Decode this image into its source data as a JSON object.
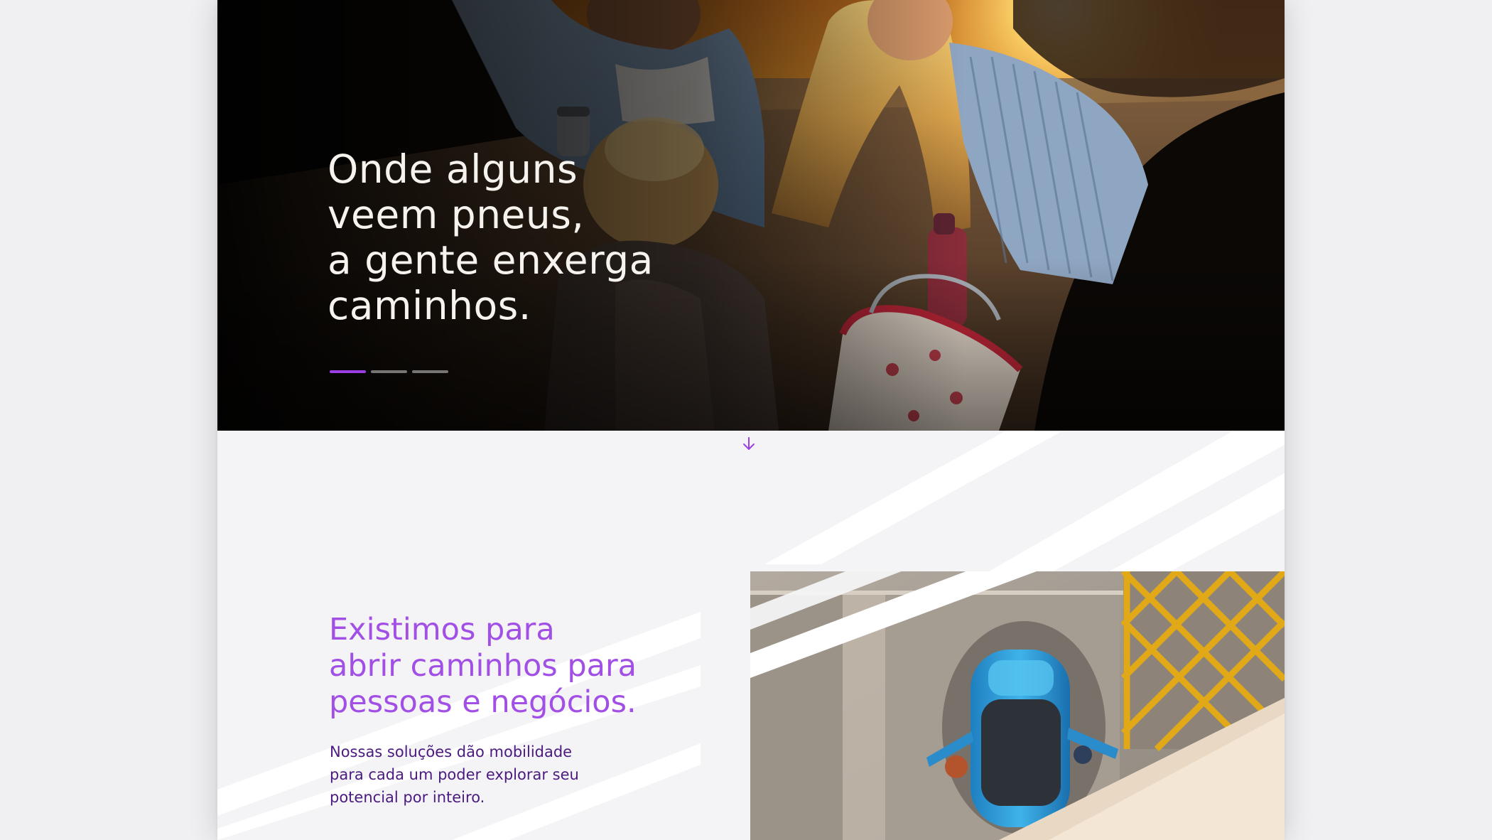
{
  "hero": {
    "title_lines": [
      "Onde alguns",
      "veem pneus,",
      "a gente enxerga",
      "caminhos."
    ],
    "slides": {
      "count": 3,
      "active_index": 0
    },
    "photo_icon": "family-sunset-photo"
  },
  "scroll_hint": {
    "icon": "arrow-down-icon"
  },
  "about": {
    "tagline_lines": [
      "Existimos para",
      "abrir caminhos para",
      "pessoas e negócios."
    ],
    "description_lines": [
      "Nossas soluções dão mobilidade",
      "para cada um poder explorar seu",
      "potencial por inteiro."
    ],
    "photo_icon": "car-aerial-photo"
  },
  "colors": {
    "accent": "#9b3fe4",
    "tagline": "#a24fe6",
    "description": "#4a1a80",
    "hero_text": "#f6f3ef",
    "section_bg": "#f4f4f6"
  }
}
